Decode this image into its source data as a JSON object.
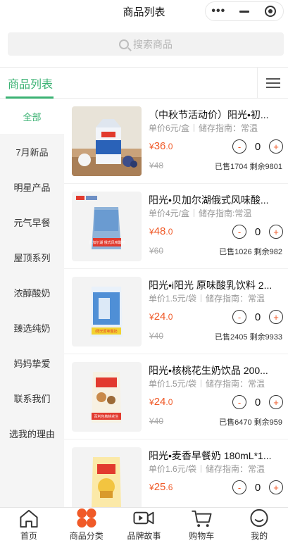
{
  "nav": {
    "title": "商品列表"
  },
  "search": {
    "placeholder": "搜索商品"
  },
  "tabs": {
    "active_label": "商品列表"
  },
  "sidebar": {
    "items": [
      {
        "label": "全部"
      },
      {
        "label": "7月新品"
      },
      {
        "label": "明星产品"
      },
      {
        "label": "元气早餐"
      },
      {
        "label": "屋顶系列"
      },
      {
        "label": "浓醇酸奶"
      },
      {
        "label": "臻选纯奶"
      },
      {
        "label": "妈妈挚爱"
      },
      {
        "label": "联系我们"
      },
      {
        "label": "选我的理由"
      }
    ]
  },
  "products": [
    {
      "name": "（中秋节活动价）阳光•初...",
      "unit_price": "单价6元/盒",
      "storage": "储存指南：常温",
      "price_symbol": "¥",
      "price_int": "36",
      "price_dec": ".0",
      "old_price": "¥48",
      "stock": "已售1704 剩余9801",
      "qty": "0",
      "minus": "-",
      "plus": "+",
      "thumb_text": ""
    },
    {
      "name": "阳光•贝加尔湖俄式风味酸...",
      "unit_price": "单价4元/盒",
      "storage": "储存指南:常温",
      "price_symbol": "¥",
      "price_int": "48",
      "price_dec": ".0",
      "old_price": "¥60",
      "stock": "已售1026 剩余982",
      "qty": "0",
      "minus": "-",
      "plus": "+",
      "thumb_text": "贝加尔湖 俄式风味酸奶"
    },
    {
      "name": "阳光•i阳光 原味酸乳饮料 2...",
      "unit_price": "单价1.5元/袋",
      "storage": "储存指南：常温",
      "price_symbol": "¥",
      "price_int": "24",
      "price_dec": ".0",
      "old_price": "¥40",
      "stock": "已售2405 剩余9933",
      "qty": "0",
      "minus": "-",
      "plus": "+",
      "thumb_text": "i阳光原味酸奶"
    },
    {
      "name": "阳光•核桃花生奶饮品 200...",
      "unit_price": "单价1.5元/袋",
      "storage": "储存指南：常温",
      "price_symbol": "¥",
      "price_int": "24",
      "price_dec": ".0",
      "old_price": "¥40",
      "stock": "已售6470 剩余959",
      "qty": "0",
      "minus": "-",
      "plus": "+",
      "thumb_text": "百利包核桃花生"
    },
    {
      "name": "阳光•麦香早餐奶 180mL*1...",
      "unit_price": "单价1.6元/袋",
      "storage": "储存指南：常温",
      "price_symbol": "¥",
      "price_int": "25",
      "price_dec": ".6",
      "old_price": "",
      "stock": "",
      "qty": "0",
      "minus": "-",
      "plus": "+",
      "thumb_text": ""
    }
  ],
  "bottom_bar": {
    "items": [
      {
        "label": "首页"
      },
      {
        "label": "商品分类"
      },
      {
        "label": "品牌故事"
      },
      {
        "label": "购物车"
      },
      {
        "label": "我的"
      }
    ]
  },
  "colors": {
    "accent": "#3bb273",
    "price": "#f05a28",
    "category_icon": "#f05a28"
  }
}
